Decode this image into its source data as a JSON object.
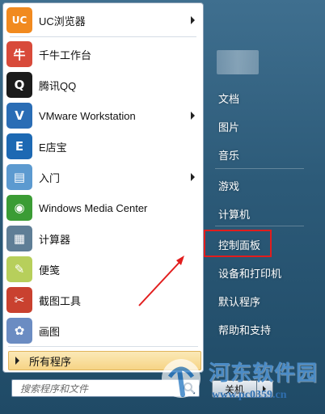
{
  "programs": [
    {
      "label": "UC浏览器",
      "icon": "uc-browser-icon",
      "color": "#f18a1f",
      "glyph": "UC",
      "submenu": true
    },
    {
      "label": "千牛工作台",
      "icon": "qianniu-icon",
      "color": "#d84a3a",
      "glyph": "牛",
      "submenu": false
    },
    {
      "label": "腾讯QQ",
      "icon": "qq-penguin-icon",
      "color": "#1b1b1b",
      "glyph": "Q",
      "submenu": false
    },
    {
      "label": "VMware Workstation",
      "icon": "vmware-icon",
      "color": "#2a6db5",
      "glyph": "V",
      "submenu": true
    },
    {
      "label": "E店宝",
      "icon": "edianbao-icon",
      "color": "#1d69b3",
      "glyph": "E",
      "submenu": false
    },
    {
      "label": "入门",
      "icon": "getting-started-icon",
      "color": "#5c9ad0",
      "glyph": "▤",
      "submenu": true
    },
    {
      "label": "Windows Media Center",
      "icon": "media-center-icon",
      "color": "#3b9c35",
      "glyph": "◉",
      "submenu": false
    },
    {
      "label": "计算器",
      "icon": "calculator-icon",
      "color": "#5f7e96",
      "glyph": "▦",
      "submenu": false
    },
    {
      "label": "便笺",
      "icon": "sticky-notes-icon",
      "color": "#b7cf5b",
      "glyph": "✎",
      "submenu": false
    },
    {
      "label": "截图工具",
      "icon": "snipping-tool-icon",
      "color": "#c9412f",
      "glyph": "✂",
      "submenu": false
    },
    {
      "label": "画图",
      "icon": "paint-icon",
      "color": "#6b8cc2",
      "glyph": "✿",
      "submenu": false
    }
  ],
  "all_programs_label": "所有程序",
  "search": {
    "placeholder": "搜索程序和文件"
  },
  "right_menu": [
    {
      "label": "文档",
      "name": "documents"
    },
    {
      "label": "图片",
      "name": "pictures"
    },
    {
      "label": "音乐",
      "name": "music"
    },
    {
      "label": "游戏",
      "name": "games"
    },
    {
      "label": "计算机",
      "name": "computer"
    },
    {
      "label": "控制面板",
      "name": "control-panel"
    },
    {
      "label": "设备和打印机",
      "name": "devices-and-printers"
    },
    {
      "label": "默认程序",
      "name": "default-programs"
    },
    {
      "label": "帮助和支持",
      "name": "help-and-support"
    }
  ],
  "shutdown_label": "关机",
  "watermark": {
    "text": "河东软件园",
    "url": "www.pc0359.cn"
  },
  "colors": {
    "highlight": "#e21d1d",
    "all_programs_bg": "#f6d486"
  }
}
